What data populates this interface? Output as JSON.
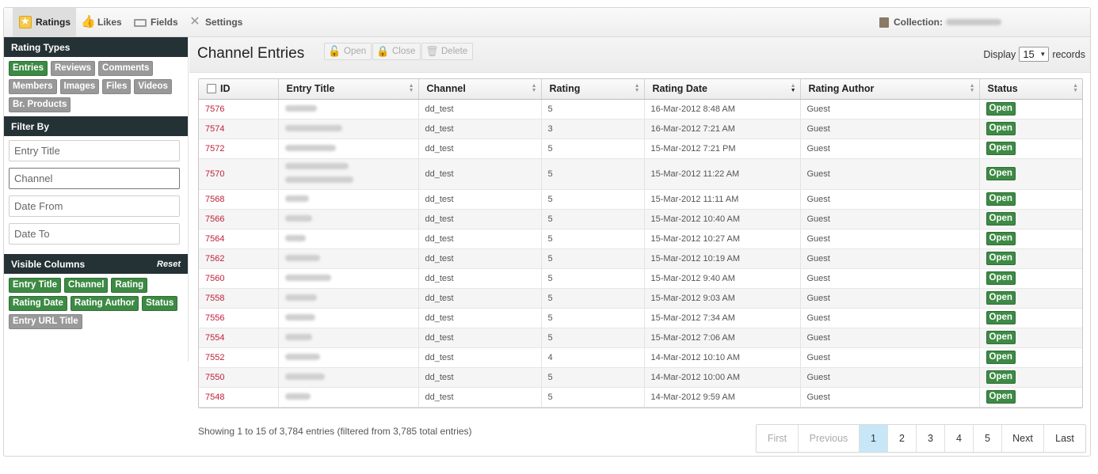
{
  "tabs": [
    {
      "label": "Ratings",
      "icon": "star-icon",
      "active": true
    },
    {
      "label": "Likes",
      "icon": "thumbs-up-icon"
    },
    {
      "label": "Fields",
      "icon": "fields-icon"
    },
    {
      "label": "Settings",
      "icon": "tools-icon"
    }
  ],
  "collection": {
    "label": "Collection:"
  },
  "sidebar": {
    "rating_types": {
      "title": "Rating Types",
      "items": [
        "Entries",
        "Reviews",
        "Comments",
        "Members",
        "Images",
        "Files",
        "Videos",
        "Br. Products"
      ]
    },
    "filter_by": {
      "title": "Filter By",
      "fields": [
        "Entry Title",
        "Channel",
        "Date From",
        "Date To"
      ]
    },
    "visible_columns": {
      "title": "Visible Columns",
      "reset": "Reset",
      "items": [
        "Entry Title",
        "Channel",
        "Rating",
        "Rating Date",
        "Rating Author",
        "Status",
        "Entry URL Title"
      ]
    }
  },
  "main": {
    "title": "Channel Entries",
    "toolbar": {
      "open": "Open",
      "close": "Close",
      "delete": "Delete"
    },
    "display": {
      "prefix": "Display",
      "value": "15",
      "suffix": "records"
    },
    "columns": [
      "ID",
      "Entry Title",
      "Channel",
      "Rating",
      "Rating Date",
      "Rating Author",
      "Status"
    ],
    "rows": [
      {
        "id": "7576",
        "channel": "dd_test",
        "rating": "5",
        "date": "16-Mar-2012 8:48 AM",
        "author": "Guest",
        "status": "Open"
      },
      {
        "id": "7574",
        "channel": "dd_test",
        "rating": "3",
        "date": "16-Mar-2012 7:21 AM",
        "author": "Guest",
        "status": "Open"
      },
      {
        "id": "7572",
        "channel": "dd_test",
        "rating": "5",
        "date": "15-Mar-2012 7:21 PM",
        "author": "Guest",
        "status": "Open"
      },
      {
        "id": "7570",
        "channel": "dd_test",
        "rating": "5",
        "date": "15-Mar-2012 11:22 AM",
        "author": "Guest",
        "status": "Open"
      },
      {
        "id": "7568",
        "channel": "dd_test",
        "rating": "5",
        "date": "15-Mar-2012 11:11 AM",
        "author": "Guest",
        "status": "Open"
      },
      {
        "id": "7566",
        "channel": "dd_test",
        "rating": "5",
        "date": "15-Mar-2012 10:40 AM",
        "author": "Guest",
        "status": "Open"
      },
      {
        "id": "7564",
        "channel": "dd_test",
        "rating": "5",
        "date": "15-Mar-2012 10:27 AM",
        "author": "Guest",
        "status": "Open"
      },
      {
        "id": "7562",
        "channel": "dd_test",
        "rating": "5",
        "date": "15-Mar-2012 10:19 AM",
        "author": "Guest",
        "status": "Open"
      },
      {
        "id": "7560",
        "channel": "dd_test",
        "rating": "5",
        "date": "15-Mar-2012 9:40 AM",
        "author": "Guest",
        "status": "Open"
      },
      {
        "id": "7558",
        "channel": "dd_test",
        "rating": "5",
        "date": "15-Mar-2012 9:03 AM",
        "author": "Guest",
        "status": "Open"
      },
      {
        "id": "7556",
        "channel": "dd_test",
        "rating": "5",
        "date": "15-Mar-2012 7:34 AM",
        "author": "Guest",
        "status": "Open"
      },
      {
        "id": "7554",
        "channel": "dd_test",
        "rating": "5",
        "date": "15-Mar-2012 7:06 AM",
        "author": "Guest",
        "status": "Open"
      },
      {
        "id": "7552",
        "channel": "dd_test",
        "rating": "4",
        "date": "14-Mar-2012 10:10 AM",
        "author": "Guest",
        "status": "Open"
      },
      {
        "id": "7550",
        "channel": "dd_test",
        "rating": "5",
        "date": "14-Mar-2012 10:00 AM",
        "author": "Guest",
        "status": "Open"
      },
      {
        "id": "7548",
        "channel": "dd_test",
        "rating": "5",
        "date": "14-Mar-2012 9:59 AM",
        "author": "Guest",
        "status": "Open"
      }
    ],
    "info": "Showing 1 to 15 of 3,784 entries (filtered from 3,785 total entries)",
    "pagination": {
      "first": "First",
      "previous": "Previous",
      "pages": [
        "1",
        "2",
        "3",
        "4",
        "5"
      ],
      "current": "1",
      "next": "Next",
      "last": "Last"
    }
  },
  "colors": {
    "sidebar_header": "#243135",
    "chip_green": "#3d8a44",
    "chip_grey": "#999999",
    "id_link": "#c0203a",
    "pager_current": "#c7e6f8"
  }
}
